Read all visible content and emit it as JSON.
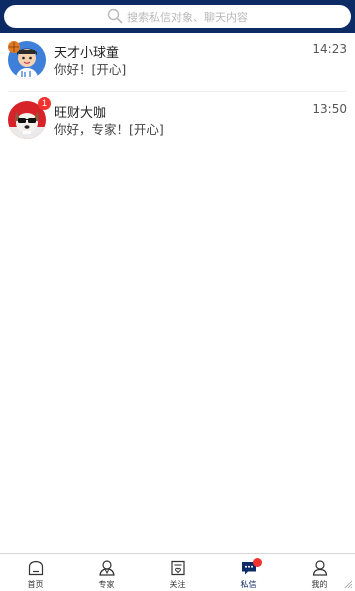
{
  "search": {
    "placeholder": "搜索私信对象、聊天内容"
  },
  "conversations": [
    {
      "name": "天才小球童",
      "last_message": "你好！[开心]",
      "time": "14:23",
      "unread": ""
    },
    {
      "name": "旺财大咖",
      "last_message": "你好，专家！[开心]",
      "time": "13:50",
      "unread": "1"
    }
  ],
  "tabs": [
    {
      "label": "首页",
      "icon": "home-icon"
    },
    {
      "label": "专家",
      "icon": "expert-icon"
    },
    {
      "label": "关注",
      "icon": "follow-icon"
    },
    {
      "label": "私信",
      "icon": "message-icon",
      "active": true
    },
    {
      "label": "我的",
      "icon": "profile-icon"
    }
  ],
  "colors": {
    "header": "#0c2a63",
    "badge": "#f1332f",
    "active_tab": "#0c2a63"
  }
}
